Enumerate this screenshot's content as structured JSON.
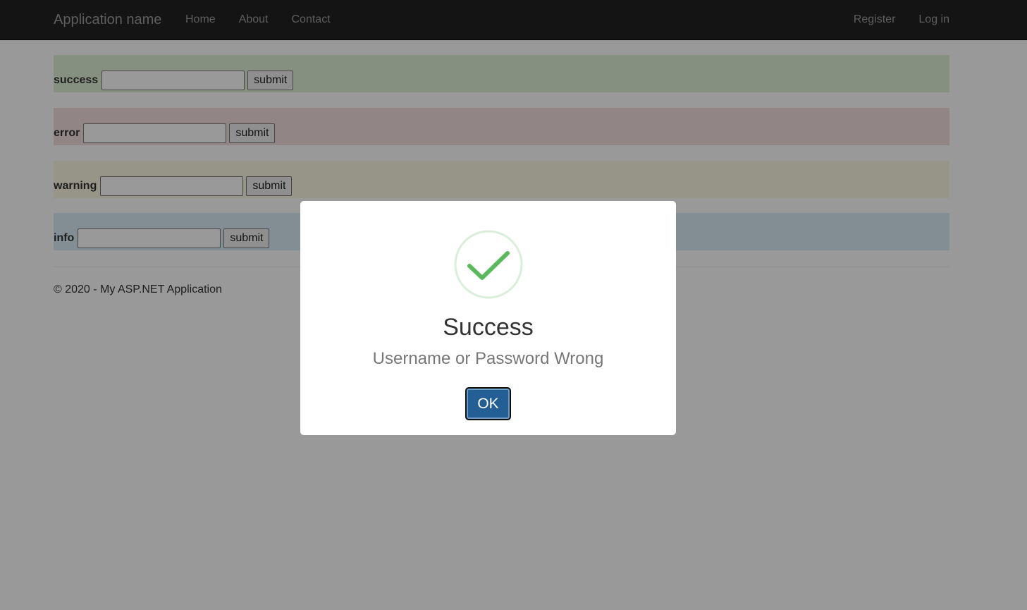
{
  "navbar": {
    "brand": "Application name",
    "left_links": [
      "Home",
      "About",
      "Contact"
    ],
    "right_links": [
      "Register",
      "Log in"
    ]
  },
  "rows": [
    {
      "label": "success",
      "button": "submit",
      "color": "#dff0d8"
    },
    {
      "label": "error",
      "button": "submit",
      "color": "#f2dede"
    },
    {
      "label": "warning",
      "button": "submit",
      "color": "#fcf8e3"
    },
    {
      "label": "info",
      "button": "submit",
      "color": "#d9edf7"
    }
  ],
  "footer": {
    "text": "© 2020 - My ASP.NET Application"
  },
  "modal": {
    "icon": "success-check-icon",
    "icon_color": "#5cb85c",
    "title": "Success",
    "text": "Username or Password Wrong",
    "ok_label": "OK",
    "button_color": "#235f94"
  }
}
